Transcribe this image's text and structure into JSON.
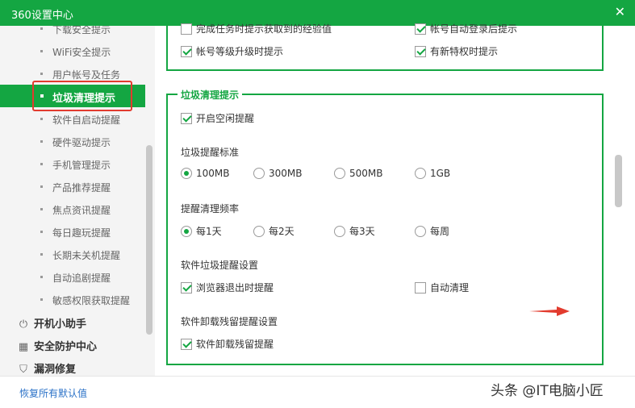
{
  "window": {
    "title": "360设置中心",
    "close_glyph": "✕"
  },
  "sidebar": {
    "sub_items": [
      {
        "label": "下载安全提示"
      },
      {
        "label": "WiFi安全提示"
      },
      {
        "label": "用户帐号及任务"
      },
      {
        "label": "垃圾清理提示"
      },
      {
        "label": "软件自启动提醒"
      },
      {
        "label": "硬件驱动提示"
      },
      {
        "label": "手机管理提示"
      },
      {
        "label": "产品推荐提醒"
      },
      {
        "label": "焦点资讯提醒"
      },
      {
        "label": "每日趣玩提醒"
      },
      {
        "label": "长期未关机提醒"
      },
      {
        "label": "自动追剧提醒"
      },
      {
        "label": "敏感权限获取提醒"
      }
    ],
    "active_index": 3,
    "groups": [
      {
        "label": "开机小助手",
        "icon": "power-icon",
        "glyph": "⏻"
      },
      {
        "label": "安全防护中心",
        "icon": "grid-icon",
        "glyph": "▦"
      },
      {
        "label": "漏洞修复",
        "icon": "shield-icon",
        "glyph": "⛉"
      }
    ]
  },
  "top_section": {
    "row1": [
      {
        "label": "完成任务时提示获取到的经验值",
        "checked": false
      },
      {
        "label": "帐号自动登录后提示",
        "checked": true
      }
    ],
    "row2": [
      {
        "label": "帐号等级升级时提示",
        "checked": true
      },
      {
        "label": "有新特权时提示",
        "checked": true
      }
    ]
  },
  "junk_section": {
    "title": "垃圾清理提示",
    "idle_reminder": {
      "label": "开启空闲提醒",
      "checked": true
    },
    "threshold": {
      "label": "垃圾提醒标准",
      "options": [
        "100MB",
        "300MB",
        "500MB",
        "1GB"
      ],
      "selected": "100MB"
    },
    "frequency": {
      "label": "提醒清理频率",
      "options": [
        "每1天",
        "每2天",
        "每3天",
        "每周"
      ],
      "selected": "每1天"
    },
    "software_junk": {
      "label": "软件垃圾提醒设置",
      "browser_exit": {
        "label": "浏览器退出时提醒",
        "checked": true
      },
      "auto_clean": {
        "label": "自动清理",
        "checked": false
      }
    },
    "uninstall": {
      "label": "软件卸载残留提醒设置",
      "option": {
        "label": "软件卸载残留提醒",
        "checked": true
      }
    }
  },
  "footer": {
    "restore_label": "恢复所有默认值",
    "watermark": "头条 @IT电脑小匠"
  },
  "colors": {
    "accent": "#14a642",
    "link": "#2a71c7",
    "highlight": "#e23b2e"
  }
}
